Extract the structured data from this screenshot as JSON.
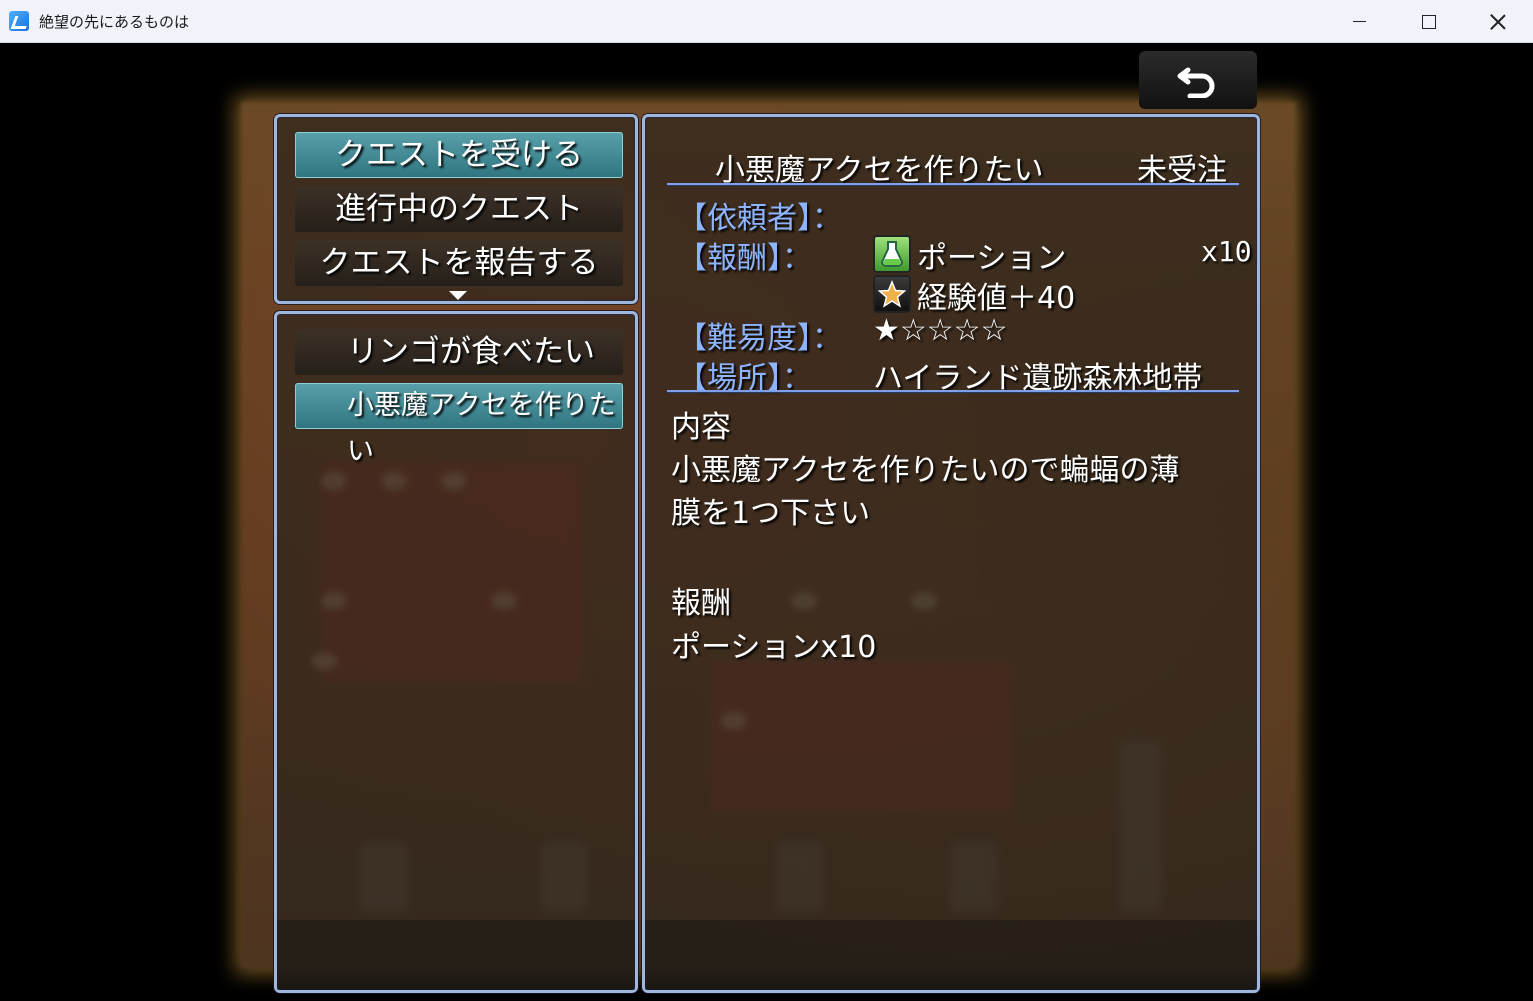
{
  "window": {
    "title": "絶望の先にあるものは"
  },
  "commands": [
    {
      "label": "クエストを受ける",
      "selected": true
    },
    {
      "label": "進行中のクエスト",
      "selected": false
    },
    {
      "label": "クエストを報告する",
      "selected": false
    }
  ],
  "quests": [
    {
      "label": "リンゴが食べたい",
      "selected": false
    },
    {
      "label": "小悪魔アクセを作りたい",
      "selected": true
    }
  ],
  "detail": {
    "title": "小悪魔アクセを作りたい",
    "status": "未受注",
    "client_label": "【依頼者】：",
    "reward_label": "【報酬】：",
    "rewards": [
      {
        "icon": "potion-icon",
        "name": "ポーション",
        "qty": "x10"
      },
      {
        "icon": "star-icon",
        "name": "経験値＋40",
        "qty": ""
      }
    ],
    "difficulty_label": "【難易度】：",
    "difficulty": "★☆☆☆☆",
    "location_label": "【場所】：",
    "location": "ハイランド遺跡森林地帯",
    "content_heading": "内容",
    "content_line1": "小悪魔アクセを作りたいので蝙蝠の薄",
    "content_line2": "膜を1つ下さい",
    "reward_heading": "報酬",
    "reward_summary": "ポーションx10"
  },
  "colors": {
    "panel_border": "#9fb6dd",
    "selected_bg": "#3f8a95",
    "label_blue": "#8db4ff"
  }
}
